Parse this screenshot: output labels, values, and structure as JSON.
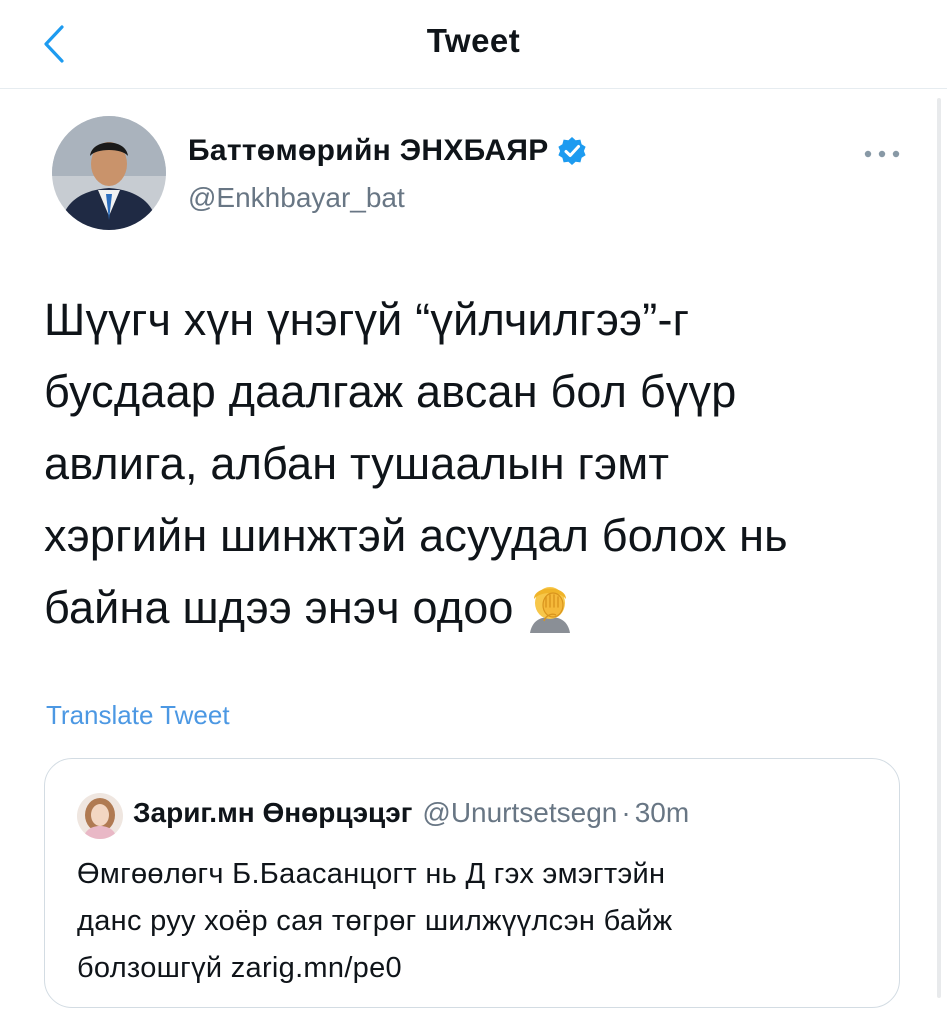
{
  "header": {
    "title": "Tweet",
    "back_icon": "chevron-left-icon",
    "accent_color": "#1d9bf0"
  },
  "tweet": {
    "author_name": "Баттөмөрийн ЭНХБАЯР",
    "author_handle": "@Enkhbayar_bat",
    "verified": true,
    "more_icon": "more-horizontal-icon",
    "text_lines": [
      "Шүүгч хүн үнэгүй “үйлчилгээ”-г",
      "бусдаар даалгаж авсан бол бүүр",
      "авлига, албан тушаалын гэмт",
      "хэргийн шинжтэй асуудал болох нь",
      "байна шдээ энэч одоо"
    ],
    "emoji": "face-palm-emoji",
    "translate_label": "Translate Tweet"
  },
  "quote": {
    "author_name": "Зариг.мн Өнөрцэцэг",
    "author_handle": "@Unurtsetsegn",
    "separator": "·",
    "time": "30m",
    "text_lines": [
      "Өмгөөлөгч Б.Баасанцогт нь Д гэх эмэгтэйн",
      "данс руу хоёр сая төгрөг шилжүүлсэн байж",
      "болзошгүй zarig.mn/pe0"
    ]
  }
}
